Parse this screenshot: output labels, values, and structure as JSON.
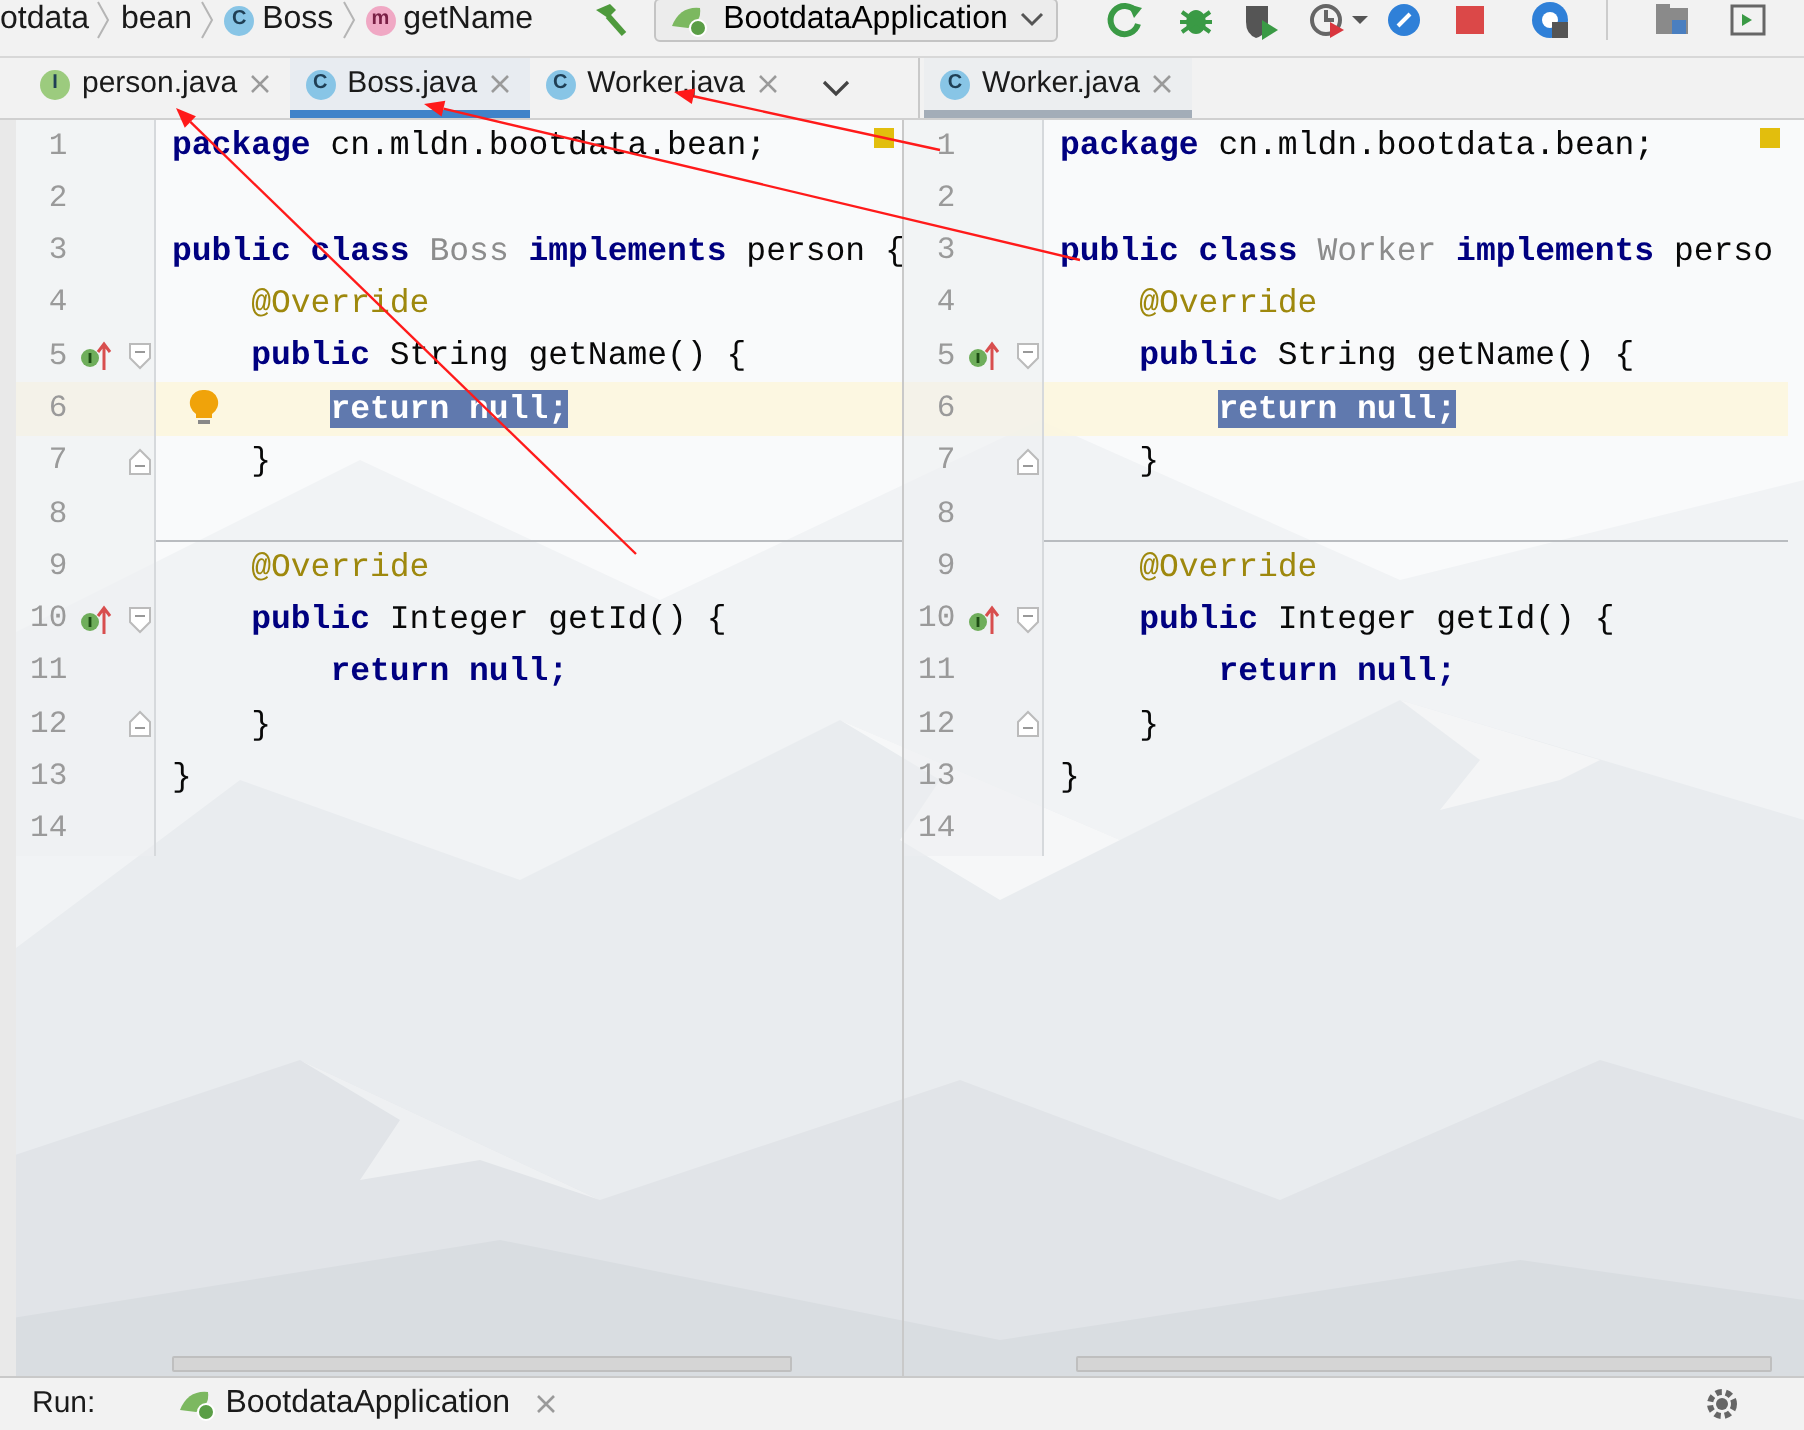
{
  "breadcrumb": [
    {
      "label": "otdata",
      "kind": "package"
    },
    {
      "label": "bean",
      "kind": "package"
    },
    {
      "label": "Boss",
      "kind": "class",
      "icon_letter": "C"
    },
    {
      "label": "getName",
      "kind": "method",
      "icon_letter": "m"
    }
  ],
  "run_configuration": {
    "label": "BootdataApplication"
  },
  "editors": [
    {
      "focused": true,
      "overflow_menu": true,
      "tabs": [
        {
          "label": "person.java",
          "kind": "interface",
          "icon_letter": "I",
          "selected": false
        },
        {
          "label": "Boss.java",
          "kind": "class",
          "icon_letter": "C",
          "selected": true
        },
        {
          "label": "Worker.java",
          "kind": "class",
          "icon_letter": "C",
          "selected": false
        }
      ],
      "lines": [
        {
          "number": "1",
          "current": false,
          "tokens": [
            {
              "text": "package ",
              "kind": "keyword"
            },
            {
              "text": "cn.mldn.bootdata.bean;",
              "kind": "plain"
            }
          ]
        },
        {
          "number": "2",
          "current": false
        },
        {
          "number": "3",
          "current": false,
          "tokens": [
            {
              "text": "public class ",
              "kind": "keyword"
            },
            {
              "text": "Boss ",
              "kind": "unused"
            },
            {
              "text": "implements ",
              "kind": "keyword"
            },
            {
              "text": "person {",
              "kind": "plain"
            }
          ],
          "children": [
            {
              "number": "4",
              "current": false,
              "tokens": [
                {
                  "text": "@Override",
                  "kind": "annotation"
                }
              ]
            },
            {
              "number": "5",
              "current": false,
              "implements_marker": true,
              "fold_start": true,
              "tokens": [
                {
                  "text": "public ",
                  "kind": "keyword"
                },
                {
                  "text": "String getName() {",
                  "kind": "plain"
                }
              ],
              "children": [
                {
                  "number": "6",
                  "current": true,
                  "bulb": true,
                  "tokens": [
                    {
                      "text": "return null;",
                      "kind": "selection"
                    }
                  ]
                }
              ]
            },
            {
              "number": "7",
              "current": false,
              "fold_end": true,
              "tokens": [
                {
                  "text": "}",
                  "kind": "plain"
                }
              ]
            },
            {
              "number": "8",
              "current": false
            },
            {
              "number": "9",
              "current": false,
              "separator": true,
              "tokens": [
                {
                  "text": "@Override",
                  "kind": "annotation"
                }
              ]
            },
            {
              "number": "10",
              "current": false,
              "implements_marker": true,
              "fold_start": true,
              "tokens": [
                {
                  "text": "public ",
                  "kind": "keyword"
                },
                {
                  "text": "Integer getId() {",
                  "kind": "plain"
                }
              ],
              "children": [
                {
                  "number": "11",
                  "current": false,
                  "tokens": [
                    {
                      "text": "return null;",
                      "kind": "keyword"
                    }
                  ]
                }
              ]
            },
            {
              "number": "12",
              "current": false,
              "fold_end": true,
              "tokens": [
                {
                  "text": "}",
                  "kind": "plain"
                }
              ]
            }
          ]
        },
        {
          "number": "13",
          "current": false,
          "tokens": [
            {
              "text": "}",
              "kind": "plain"
            }
          ]
        },
        {
          "number": "14",
          "current": false
        }
      ]
    },
    {
      "focused": false,
      "overflow_menu": false,
      "tabs": [
        {
          "label": "Worker.java",
          "kind": "class",
          "icon_letter": "C",
          "selected": true
        }
      ],
      "lines": [
        {
          "number": "1",
          "current": false,
          "tokens": [
            {
              "text": "package ",
              "kind": "keyword"
            },
            {
              "text": "cn.mldn.bootdata.bean;",
              "kind": "plain"
            }
          ]
        },
        {
          "number": "2",
          "current": false
        },
        {
          "number": "3",
          "current": false,
          "tokens": [
            {
              "text": "public class ",
              "kind": "keyword"
            },
            {
              "text": "Worker ",
              "kind": "unused"
            },
            {
              "text": "implements ",
              "kind": "keyword"
            },
            {
              "text": "perso",
              "kind": "plain"
            }
          ],
          "children": [
            {
              "number": "4",
              "current": false,
              "tokens": [
                {
                  "text": "@Override",
                  "kind": "annotation"
                }
              ]
            },
            {
              "number": "5",
              "current": false,
              "implements_marker": true,
              "fold_start": true,
              "tokens": [
                {
                  "text": "public ",
                  "kind": "keyword"
                },
                {
                  "text": "String getName() {",
                  "kind": "plain"
                }
              ],
              "children": [
                {
                  "number": "6",
                  "current": true,
                  "tokens": [
                    {
                      "text": "return null;",
                      "kind": "selection"
                    }
                  ]
                }
              ]
            },
            {
              "number": "7",
              "current": false,
              "fold_end": true,
              "tokens": [
                {
                  "text": "}",
                  "kind": "plain"
                }
              ]
            },
            {
              "number": "8",
              "current": false
            },
            {
              "number": "9",
              "current": false,
              "separator": true,
              "tokens": [
                {
                  "text": "@Override",
                  "kind": "annotation"
                }
              ]
            },
            {
              "number": "10",
              "current": false,
              "implements_marker": true,
              "fold_start": true,
              "tokens": [
                {
                  "text": "public ",
                  "kind": "keyword"
                },
                {
                  "text": "Integer getId() {",
                  "kind": "plain"
                }
              ],
              "children": [
                {
                  "number": "11",
                  "current": false,
                  "tokens": [
                    {
                      "text": "return null;",
                      "kind": "keyword"
                    }
                  ]
                }
              ]
            },
            {
              "number": "12",
              "current": false,
              "fold_end": true,
              "tokens": [
                {
                  "text": "}",
                  "kind": "plain"
                }
              ]
            }
          ]
        },
        {
          "number": "13",
          "current": false,
          "tokens": [
            {
              "text": "}",
              "kind": "plain"
            }
          ]
        },
        {
          "number": "14",
          "current": false
        }
      ]
    }
  ],
  "run_bar": {
    "label": "Run:",
    "tab": "BootdataApplication"
  }
}
